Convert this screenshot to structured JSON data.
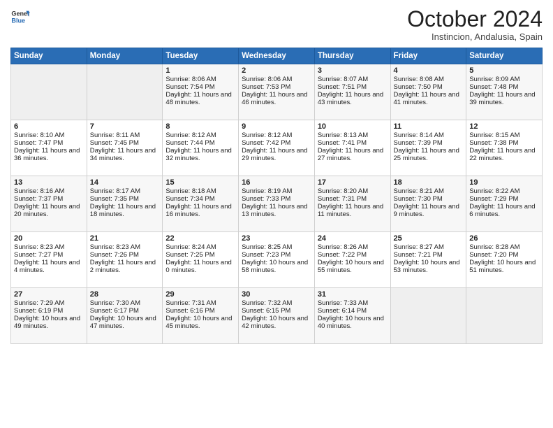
{
  "header": {
    "logo_line1": "General",
    "logo_line2": "Blue",
    "month_title": "October 2024",
    "subtitle": "Instincion, Andalusia, Spain"
  },
  "days_of_week": [
    "Sunday",
    "Monday",
    "Tuesday",
    "Wednesday",
    "Thursday",
    "Friday",
    "Saturday"
  ],
  "weeks": [
    [
      {
        "day": "",
        "sunrise": "",
        "sunset": "",
        "daylight": "",
        "empty": true
      },
      {
        "day": "",
        "sunrise": "",
        "sunset": "",
        "daylight": "",
        "empty": true
      },
      {
        "day": "1",
        "sunrise": "Sunrise: 8:06 AM",
        "sunset": "Sunset: 7:54 PM",
        "daylight": "Daylight: 11 hours and 48 minutes."
      },
      {
        "day": "2",
        "sunrise": "Sunrise: 8:06 AM",
        "sunset": "Sunset: 7:53 PM",
        "daylight": "Daylight: 11 hours and 46 minutes."
      },
      {
        "day": "3",
        "sunrise": "Sunrise: 8:07 AM",
        "sunset": "Sunset: 7:51 PM",
        "daylight": "Daylight: 11 hours and 43 minutes."
      },
      {
        "day": "4",
        "sunrise": "Sunrise: 8:08 AM",
        "sunset": "Sunset: 7:50 PM",
        "daylight": "Daylight: 11 hours and 41 minutes."
      },
      {
        "day": "5",
        "sunrise": "Sunrise: 8:09 AM",
        "sunset": "Sunset: 7:48 PM",
        "daylight": "Daylight: 11 hours and 39 minutes."
      }
    ],
    [
      {
        "day": "6",
        "sunrise": "Sunrise: 8:10 AM",
        "sunset": "Sunset: 7:47 PM",
        "daylight": "Daylight: 11 hours and 36 minutes."
      },
      {
        "day": "7",
        "sunrise": "Sunrise: 8:11 AM",
        "sunset": "Sunset: 7:45 PM",
        "daylight": "Daylight: 11 hours and 34 minutes."
      },
      {
        "day": "8",
        "sunrise": "Sunrise: 8:12 AM",
        "sunset": "Sunset: 7:44 PM",
        "daylight": "Daylight: 11 hours and 32 minutes."
      },
      {
        "day": "9",
        "sunrise": "Sunrise: 8:12 AM",
        "sunset": "Sunset: 7:42 PM",
        "daylight": "Daylight: 11 hours and 29 minutes."
      },
      {
        "day": "10",
        "sunrise": "Sunrise: 8:13 AM",
        "sunset": "Sunset: 7:41 PM",
        "daylight": "Daylight: 11 hours and 27 minutes."
      },
      {
        "day": "11",
        "sunrise": "Sunrise: 8:14 AM",
        "sunset": "Sunset: 7:39 PM",
        "daylight": "Daylight: 11 hours and 25 minutes."
      },
      {
        "day": "12",
        "sunrise": "Sunrise: 8:15 AM",
        "sunset": "Sunset: 7:38 PM",
        "daylight": "Daylight: 11 hours and 22 minutes."
      }
    ],
    [
      {
        "day": "13",
        "sunrise": "Sunrise: 8:16 AM",
        "sunset": "Sunset: 7:37 PM",
        "daylight": "Daylight: 11 hours and 20 minutes."
      },
      {
        "day": "14",
        "sunrise": "Sunrise: 8:17 AM",
        "sunset": "Sunset: 7:35 PM",
        "daylight": "Daylight: 11 hours and 18 minutes."
      },
      {
        "day": "15",
        "sunrise": "Sunrise: 8:18 AM",
        "sunset": "Sunset: 7:34 PM",
        "daylight": "Daylight: 11 hours and 16 minutes."
      },
      {
        "day": "16",
        "sunrise": "Sunrise: 8:19 AM",
        "sunset": "Sunset: 7:33 PM",
        "daylight": "Daylight: 11 hours and 13 minutes."
      },
      {
        "day": "17",
        "sunrise": "Sunrise: 8:20 AM",
        "sunset": "Sunset: 7:31 PM",
        "daylight": "Daylight: 11 hours and 11 minutes."
      },
      {
        "day": "18",
        "sunrise": "Sunrise: 8:21 AM",
        "sunset": "Sunset: 7:30 PM",
        "daylight": "Daylight: 11 hours and 9 minutes."
      },
      {
        "day": "19",
        "sunrise": "Sunrise: 8:22 AM",
        "sunset": "Sunset: 7:29 PM",
        "daylight": "Daylight: 11 hours and 6 minutes."
      }
    ],
    [
      {
        "day": "20",
        "sunrise": "Sunrise: 8:23 AM",
        "sunset": "Sunset: 7:27 PM",
        "daylight": "Daylight: 11 hours and 4 minutes."
      },
      {
        "day": "21",
        "sunrise": "Sunrise: 8:23 AM",
        "sunset": "Sunset: 7:26 PM",
        "daylight": "Daylight: 11 hours and 2 minutes."
      },
      {
        "day": "22",
        "sunrise": "Sunrise: 8:24 AM",
        "sunset": "Sunset: 7:25 PM",
        "daylight": "Daylight: 11 hours and 0 minutes."
      },
      {
        "day": "23",
        "sunrise": "Sunrise: 8:25 AM",
        "sunset": "Sunset: 7:23 PM",
        "daylight": "Daylight: 10 hours and 58 minutes."
      },
      {
        "day": "24",
        "sunrise": "Sunrise: 8:26 AM",
        "sunset": "Sunset: 7:22 PM",
        "daylight": "Daylight: 10 hours and 55 minutes."
      },
      {
        "day": "25",
        "sunrise": "Sunrise: 8:27 AM",
        "sunset": "Sunset: 7:21 PM",
        "daylight": "Daylight: 10 hours and 53 minutes."
      },
      {
        "day": "26",
        "sunrise": "Sunrise: 8:28 AM",
        "sunset": "Sunset: 7:20 PM",
        "daylight": "Daylight: 10 hours and 51 minutes."
      }
    ],
    [
      {
        "day": "27",
        "sunrise": "Sunrise: 7:29 AM",
        "sunset": "Sunset: 6:19 PM",
        "daylight": "Daylight: 10 hours and 49 minutes."
      },
      {
        "day": "28",
        "sunrise": "Sunrise: 7:30 AM",
        "sunset": "Sunset: 6:17 PM",
        "daylight": "Daylight: 10 hours and 47 minutes."
      },
      {
        "day": "29",
        "sunrise": "Sunrise: 7:31 AM",
        "sunset": "Sunset: 6:16 PM",
        "daylight": "Daylight: 10 hours and 45 minutes."
      },
      {
        "day": "30",
        "sunrise": "Sunrise: 7:32 AM",
        "sunset": "Sunset: 6:15 PM",
        "daylight": "Daylight: 10 hours and 42 minutes."
      },
      {
        "day": "31",
        "sunrise": "Sunrise: 7:33 AM",
        "sunset": "Sunset: 6:14 PM",
        "daylight": "Daylight: 10 hours and 40 minutes."
      },
      {
        "day": "",
        "sunrise": "",
        "sunset": "",
        "daylight": "",
        "empty": true
      },
      {
        "day": "",
        "sunrise": "",
        "sunset": "",
        "daylight": "",
        "empty": true
      }
    ]
  ]
}
